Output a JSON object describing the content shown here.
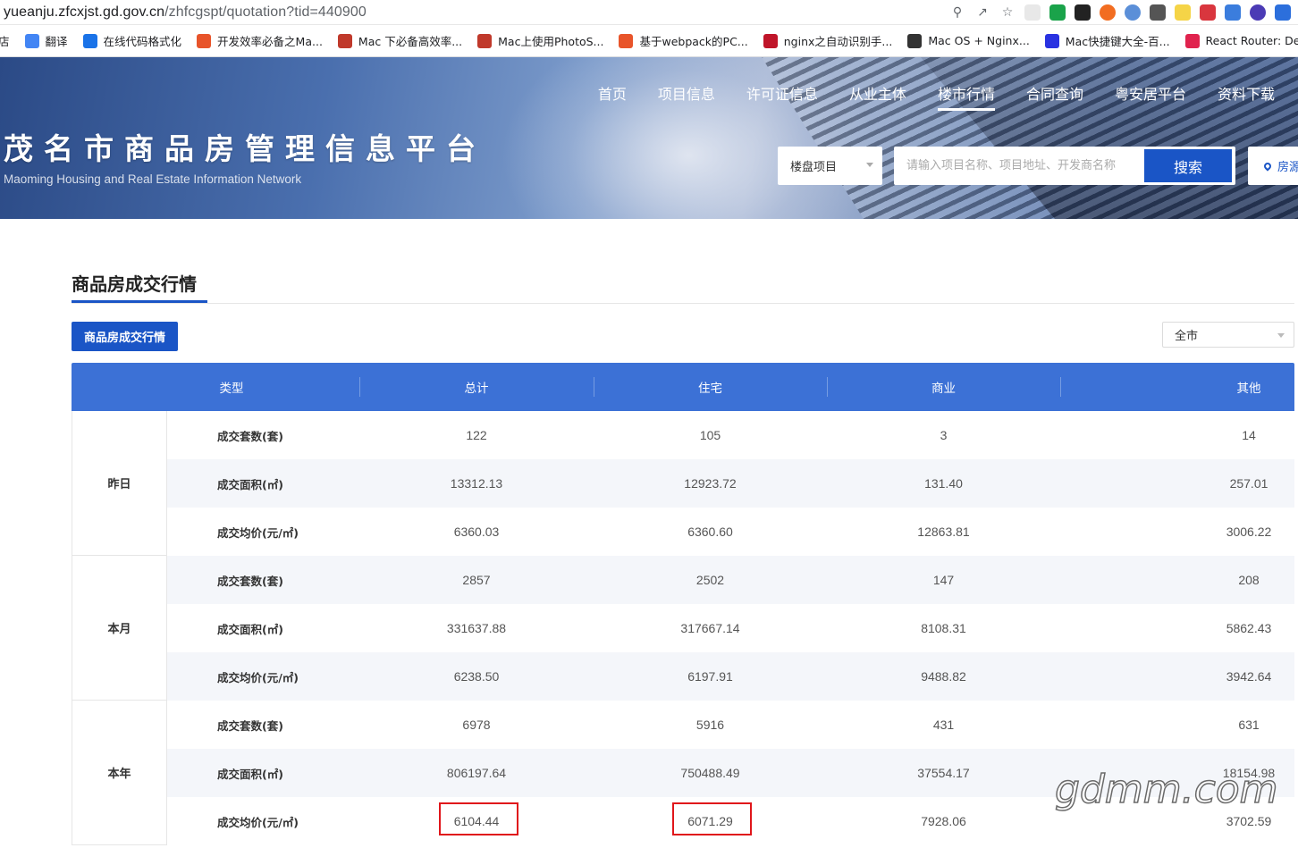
{
  "browser": {
    "url_host": "yueanju.zfcxjst.gd.gov.cn",
    "url_path": "/zhfcgspt/quotation?tid=440900",
    "bookmarks": [
      {
        "label": "店",
        "color": "#ffffff"
      },
      {
        "label": "翻译",
        "color": "#4285f4"
      },
      {
        "label": "在线代码格式化",
        "color": "#1a73e8"
      },
      {
        "label": "开发效率必备之Ma...",
        "color": "#e8542a"
      },
      {
        "label": "Mac 下必备高效率...",
        "color": "#c0392b"
      },
      {
        "label": "Mac上使用PhotoS...",
        "color": "#c0392b"
      },
      {
        "label": "基于webpack的PC...",
        "color": "#e8542a"
      },
      {
        "label": "nginx之自动识别手...",
        "color": "#c0152a"
      },
      {
        "label": "Mac OS + Nginx...",
        "color": "#333333"
      },
      {
        "label": "Mac快捷键大全-百...",
        "color": "#2932e1"
      },
      {
        "label": "React Router: Dec...",
        "color": "#e0234e"
      }
    ]
  },
  "header": {
    "title": "茂名市商品房管理信息平台",
    "subtitle": "Maoming Housing and Real Estate Information Network",
    "nav": [
      "首页",
      "项目信息",
      "许可证信息",
      "从业主体",
      "楼市行情",
      "合同查询",
      "粤安居平台",
      "资料下载"
    ],
    "active_nav": "楼市行情",
    "search_type": "楼盘项目",
    "search_placeholder": "请输入项目名称、项目地址、开发商名称",
    "search_button": "搜索",
    "house_button": "房源"
  },
  "main": {
    "section_title": "商品房成交行情",
    "tab_label": "商品房成交行情",
    "city_select": "全市",
    "columns": [
      "类型",
      "总计",
      "住宅",
      "商业",
      "其他"
    ],
    "groups": [
      {
        "label": "昨日",
        "rows": [
          {
            "metric": "成交套数(套)",
            "values": [
              "122",
              "105",
              "3",
              "14"
            ]
          },
          {
            "metric": "成交面积(㎡)",
            "values": [
              "13312.13",
              "12923.72",
              "131.40",
              "257.01"
            ]
          },
          {
            "metric": "成交均价(元/㎡)",
            "values": [
              "6360.03",
              "6360.60",
              "12863.81",
              "3006.22"
            ]
          }
        ]
      },
      {
        "label": "本月",
        "rows": [
          {
            "metric": "成交套数(套)",
            "values": [
              "2857",
              "2502",
              "147",
              "208"
            ]
          },
          {
            "metric": "成交面积(㎡)",
            "values": [
              "331637.88",
              "317667.14",
              "8108.31",
              "5862.43"
            ]
          },
          {
            "metric": "成交均价(元/㎡)",
            "values": [
              "6238.50",
              "6197.91",
              "9488.82",
              "3942.64"
            ]
          }
        ]
      },
      {
        "label": "本年",
        "rows": [
          {
            "metric": "成交套数(套)",
            "values": [
              "6978",
              "5916",
              "431",
              "631"
            ]
          },
          {
            "metric": "成交面积(㎡)",
            "values": [
              "806197.64",
              "750488.49",
              "37554.17",
              "18154.98"
            ]
          },
          {
            "metric": "成交均价(元/㎡)",
            "values": [
              "6104.44",
              "6071.29",
              "7928.06",
              "3702.59"
            ]
          }
        ]
      }
    ],
    "highlight_color": "#e0161b"
  },
  "watermark": "gdmm.com"
}
